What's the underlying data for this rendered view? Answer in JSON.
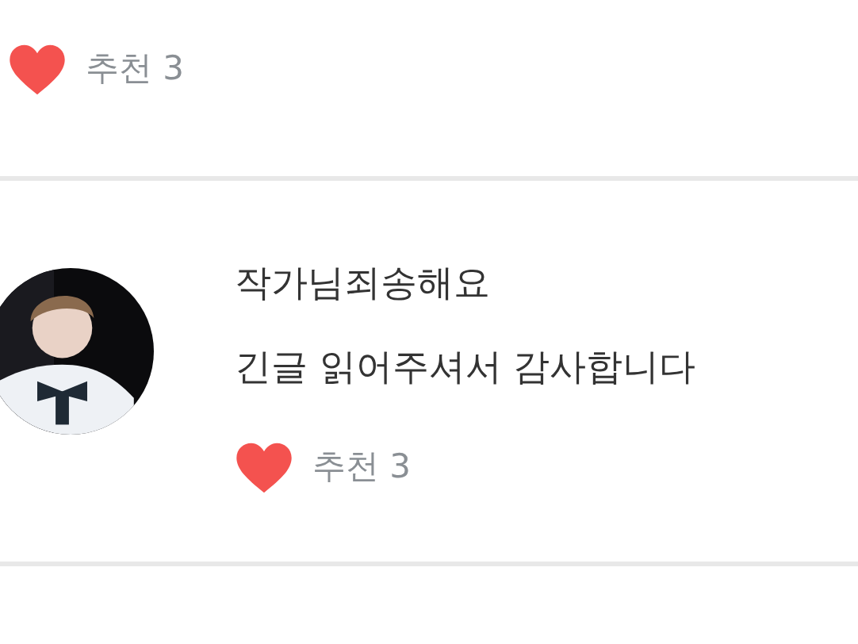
{
  "comments": [
    {
      "like_label": "추천 3"
    },
    {
      "author": "작가님죄송해요",
      "text": "긴글 읽어주셔서 감사합니다",
      "like_label": "추천 3"
    }
  ]
}
